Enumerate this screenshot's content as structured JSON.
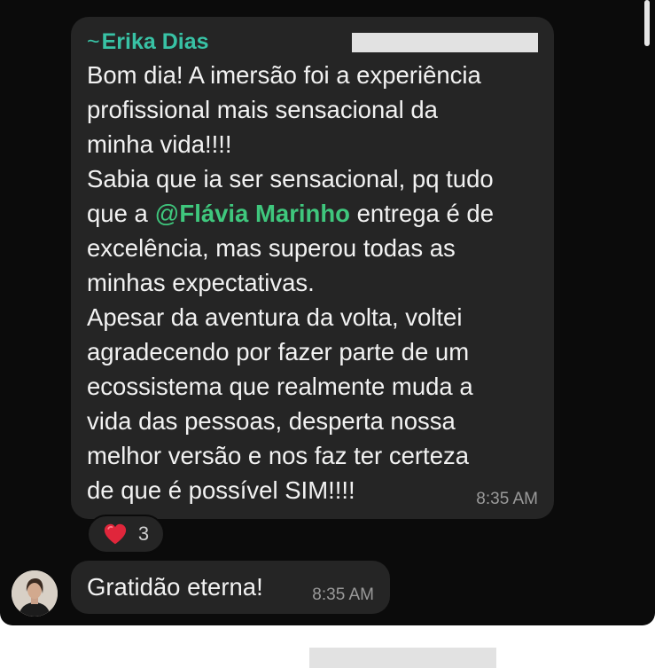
{
  "message": {
    "sender_prefix": "~",
    "sender_name": "Erika Dias",
    "text_before_mention": "Bom dia! A imersão foi a experiência\nprofissional mais sensacional da\nminha vida!!!!\nSabia que ia ser sensacional, pq tudo\nque a ",
    "mention_at": "@",
    "mention_name": "Flávia Marinho",
    "text_after_mention": " entrega é de\nexcelência, mas superou todas as\nminhas expectativas.\nApesar da aventura da volta, voltei\nagradecendo por fazer parte de um\necossistema que realmente muda a\nvida das pessoas, desperta nossa\nmelhor versão e nos faz ter certeza\nde que é possível SIM!!!!",
    "time": "8:35 AM"
  },
  "reaction": {
    "icon": "heart-icon",
    "count": "3"
  },
  "reply": {
    "text": "Gratidão eterna!",
    "time": "8:35 AM"
  },
  "colors": {
    "background": "#0b0b0b",
    "bubble": "#252525",
    "sender_name": "#38c2a5",
    "mention": "#3fc77d",
    "heart": "#e0263b"
  }
}
